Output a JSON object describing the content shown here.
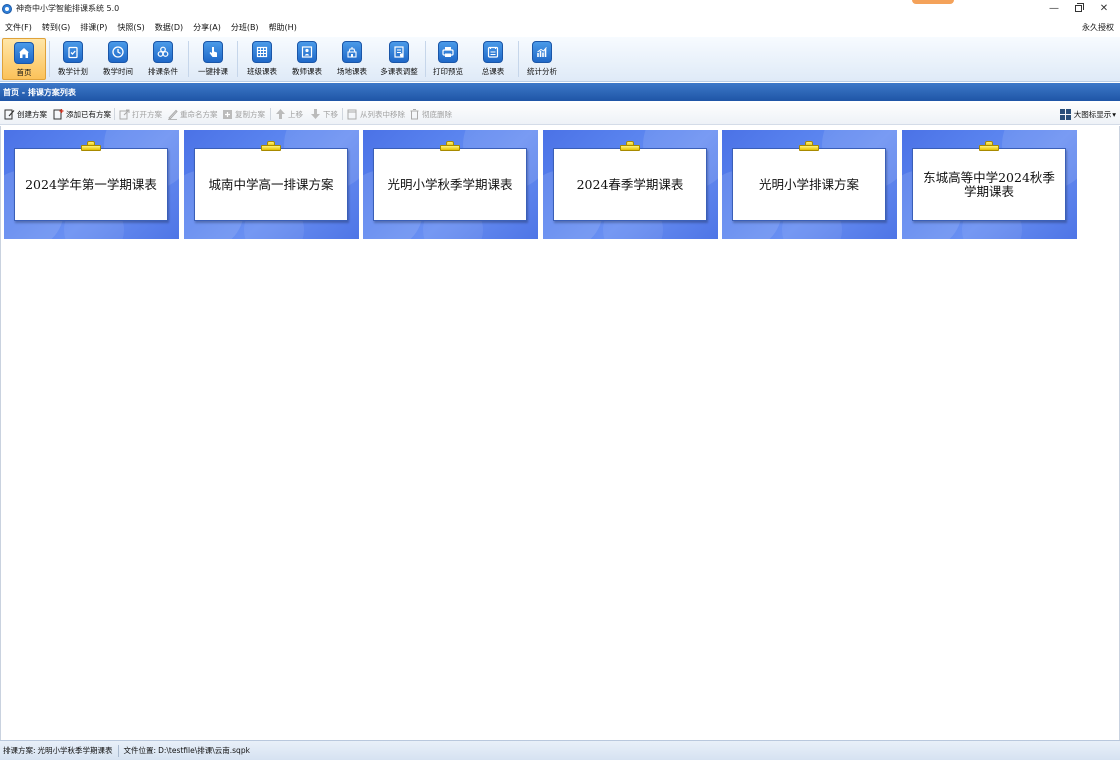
{
  "window": {
    "title": "神奇中小学智能排课系统 5.0"
  },
  "menu": {
    "items": [
      "文件(F)",
      "转到(G)",
      "排课(P)",
      "快照(S)",
      "数据(D)",
      "分享(A)",
      "分班(B)",
      "帮助(H)"
    ],
    "license": "永久授权"
  },
  "ribbon": {
    "buttons": [
      {
        "label": "首页",
        "icon": "home-icon"
      },
      {
        "label": "教学计划",
        "icon": "clipboard-icon"
      },
      {
        "label": "教学时间",
        "icon": "clock-icon"
      },
      {
        "label": "排课条件",
        "icon": "conditions-icon"
      },
      {
        "label": "一键排课",
        "icon": "hand-pointer-icon"
      },
      {
        "label": "班级课表",
        "icon": "class-grid-icon"
      },
      {
        "label": "教师课表",
        "icon": "teacher-icon"
      },
      {
        "label": "场地课表",
        "icon": "venue-icon"
      },
      {
        "label": "多课表调整",
        "icon": "multi-adjust-icon"
      },
      {
        "label": "打印预览",
        "icon": "printer-icon"
      },
      {
        "label": "总课表",
        "icon": "master-table-icon"
      },
      {
        "label": "统计分析",
        "icon": "chart-icon"
      }
    ],
    "active": "首页"
  },
  "section": {
    "title": "首页 - 排课方案列表"
  },
  "toolbar": {
    "create": "创建方案",
    "add_existing": "添加已有方案",
    "open": "打开方案",
    "rename": "重命名方案",
    "copy": "复制方案",
    "move_up": "上移",
    "move_down": "下移",
    "remove_from_list": "从列表中移除",
    "delete": "彻底删除",
    "view_mode": "大图标显示"
  },
  "plans": [
    "2024学年第一学期课表",
    "城南中学高一排课方案",
    "光明小学秋季学期课表",
    "2024春季学期课表",
    "光明小学排课方案",
    "东城高等中学2024秋季学期课表"
  ],
  "status": {
    "plan_label": "排课方案:",
    "plan_value": "光明小学秋季学期课表",
    "path_label": "文件位置:",
    "path_value": "D:\\testfile\\排课\\云南.sqpk"
  },
  "colors": {
    "header_blue": "#1f55a6",
    "card_blue": "#5a84ef",
    "active_orange": "#fbc25a"
  }
}
